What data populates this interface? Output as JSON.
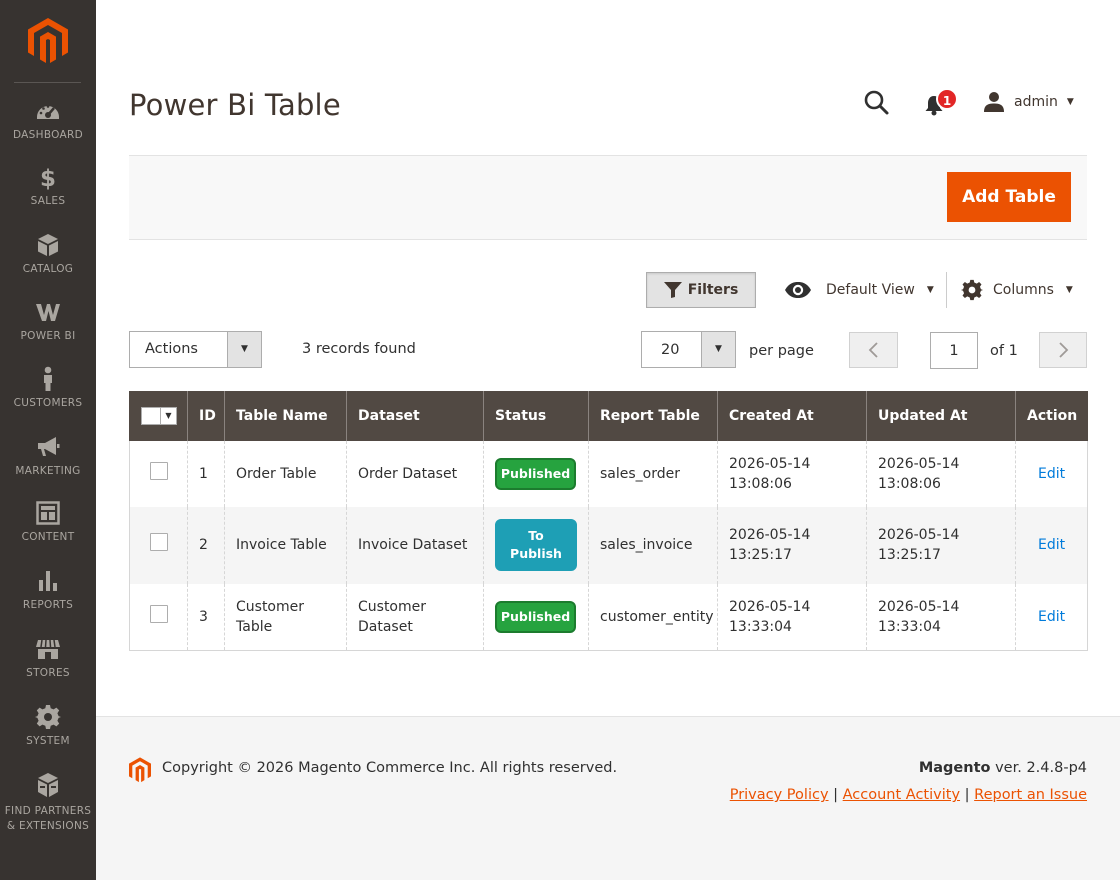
{
  "page": {
    "title": "Power Bi Table"
  },
  "sidebar": {
    "items": [
      {
        "label": "DASHBOARD",
        "icon": "dashboard-icon"
      },
      {
        "label": "SALES",
        "icon": "dollar-icon"
      },
      {
        "label": "CATALOG",
        "icon": "cube-icon"
      },
      {
        "label": "POWER BI",
        "icon": "power-bi-icon"
      },
      {
        "label": "CUSTOMERS",
        "icon": "person-icon"
      },
      {
        "label": "MARKETING",
        "icon": "megaphone-icon"
      },
      {
        "label": "CONTENT",
        "icon": "layout-icon"
      },
      {
        "label": "REPORTS",
        "icon": "bar-chart-icon"
      },
      {
        "label": "STORES",
        "icon": "store-icon"
      },
      {
        "label": "SYSTEM",
        "icon": "gear-icon"
      },
      {
        "label": "FIND PARTNERS & EXTENSIONS",
        "icon": "box-icon"
      }
    ]
  },
  "header": {
    "notifications_count": "1",
    "user_name": "admin"
  },
  "actions": {
    "add_label": "Add Table"
  },
  "grid": {
    "filters_label": "Filters",
    "view_label": "Default View",
    "columns_label": "Columns",
    "mass_action_label": "Actions",
    "records_found": "3 records found",
    "per_page_value": "20",
    "per_page_label": "per page",
    "current_page": "1",
    "of_pages": "of 1",
    "columns": [
      "ID",
      "Table Name",
      "Dataset",
      "Status",
      "Report Table",
      "Created At",
      "Updated At",
      "Action"
    ],
    "rows": [
      {
        "id": "1",
        "table_name": "Order Table",
        "dataset": "Order Dataset",
        "status": "Published",
        "status_kind": "published",
        "report_table": "sales_order",
        "created_date": "2026-05-14",
        "created_time": "13:08:06",
        "updated_date": "2026-05-14",
        "updated_time": "13:08:06",
        "action": "Edit"
      },
      {
        "id": "2",
        "table_name": "Invoice Table",
        "dataset": "Invoice Dataset",
        "status": "To Publish",
        "status_kind": "topublish",
        "report_table": "sales_invoice",
        "created_date": "2026-05-14",
        "created_time": "13:25:17",
        "updated_date": "2026-05-14",
        "updated_time": "13:25:17",
        "action": "Edit"
      },
      {
        "id": "3",
        "table_name": "Customer Table",
        "dataset": "Customer Dataset",
        "status": "Published",
        "status_kind": "published",
        "report_table": "customer_entity",
        "created_date": "2026-05-14",
        "created_time": "13:33:04",
        "updated_date": "2026-05-14",
        "updated_time": "13:33:04",
        "action": "Edit"
      }
    ]
  },
  "footer": {
    "copyright": "Copyright © 2026 Magento Commerce Inc. All rights reserved.",
    "brand": "Magento",
    "version": " ver. 2.4.8-p4",
    "links": [
      "Privacy Policy",
      " Account Activity",
      "Report an Issue"
    ]
  },
  "colors": {
    "accent": "#eb5202",
    "sidebar_bg": "#373330",
    "table_header_bg": "#514943",
    "published": "#26a33f",
    "to_publish": "#1e9fb5",
    "link": "#007bdb"
  }
}
